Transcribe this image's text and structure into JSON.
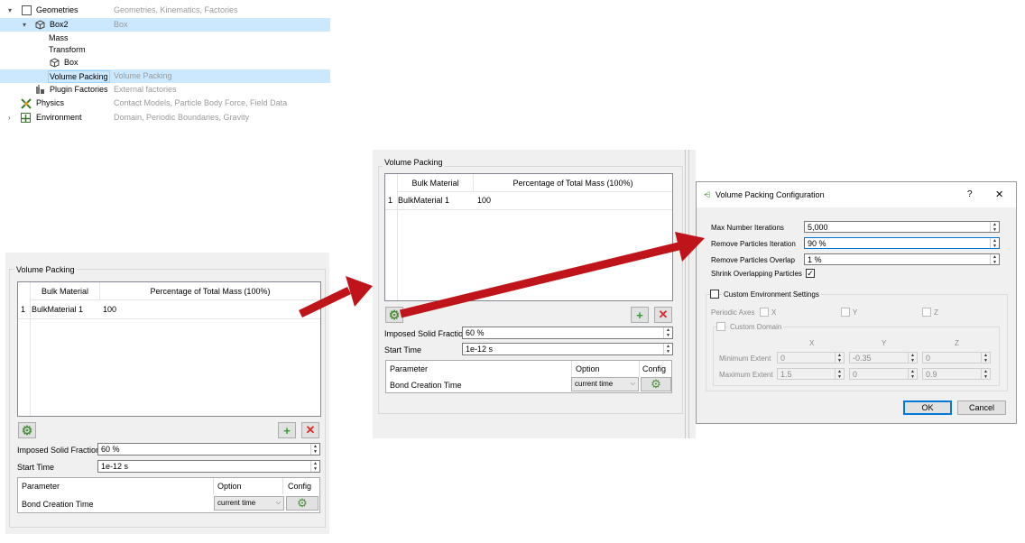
{
  "tree": {
    "items": [
      {
        "label": "Geometries",
        "desc": "Geometries, Kinematics, Factories"
      },
      {
        "label": "Box2",
        "desc": "Box"
      },
      {
        "label": "Mass",
        "desc": ""
      },
      {
        "label": "Transform",
        "desc": ""
      },
      {
        "label": "Box",
        "desc": ""
      },
      {
        "label": "Volume Packing",
        "desc": "Volume Packing"
      },
      {
        "label": "Plugin Factories",
        "desc": "External factories"
      },
      {
        "label": "Physics",
        "desc": "Contact Models, Particle Body Force, Field Data"
      },
      {
        "label": "Environment",
        "desc": "Domain, Periodic Boundaries, Gravity"
      }
    ]
  },
  "vp1": {
    "group_title": "Volume Packing",
    "col_bulk": "Bulk Material",
    "col_pct": "Percentage of Total Mass (100%)",
    "row_num": "1",
    "row_material": "BulkMaterial 1",
    "row_value": "100",
    "solid_fraction_label": "Imposed Solid Fraction",
    "solid_fraction_value": "60 %",
    "start_time_label": "Start Time",
    "start_time_value": "1e-12 s",
    "param_header": "Parameter",
    "option_header": "Option",
    "config_header": "Config",
    "param_row": "Bond Creation Time",
    "option_value": "current time"
  },
  "vp2": {
    "group_title": "Volume Packing",
    "col_bulk": "Bulk Material",
    "col_pct": "Percentage of Total Mass (100%)",
    "row_num": "1",
    "row_material": "BulkMaterial 1",
    "row_value": "100",
    "solid_fraction_label": "Imposed Solid Fraction",
    "solid_fraction_value": "60 %",
    "start_time_label": "Start Time",
    "start_time_value": "1e-12 s",
    "param_header": "Parameter",
    "option_header": "Option",
    "config_header": "Config",
    "param_row": "Bond Creation Time",
    "option_value": "current time"
  },
  "dialog": {
    "title": "Volume Packing Configuration",
    "help": "?",
    "close": "✕",
    "max_iter_label": "Max Number Iterations",
    "max_iter_value": "5,000",
    "remove_iter_label": "Remove Particles Iteration",
    "remove_iter_value": "90 %",
    "remove_overlap_label": "Remove Particles Overlap",
    "remove_overlap_value": "1 %",
    "shrink_label": "Shrink Overlapping Particles",
    "shrink_checked": "✓",
    "custom_env_label": "Custom Environment Settings",
    "periodic_label": "Periodic Axes",
    "axis_x": "X",
    "axis_y": "Y",
    "axis_z": "Z",
    "custom_domain_label": "Custom Domain",
    "min_extent_label": "Minimum Extent",
    "max_extent_label": "Maximum Extent",
    "min_x": "0",
    "min_y": "-0.35",
    "min_z": "0",
    "max_x": "1.5",
    "max_y": "0",
    "max_z": "0.9",
    "ok": "OK",
    "cancel": "Cancel"
  },
  "colors": {
    "selection": "#cce8ff",
    "arrow_red": "#c0141b",
    "add_green": "#2e9e2e",
    "remove_red": "#d92b2b"
  }
}
